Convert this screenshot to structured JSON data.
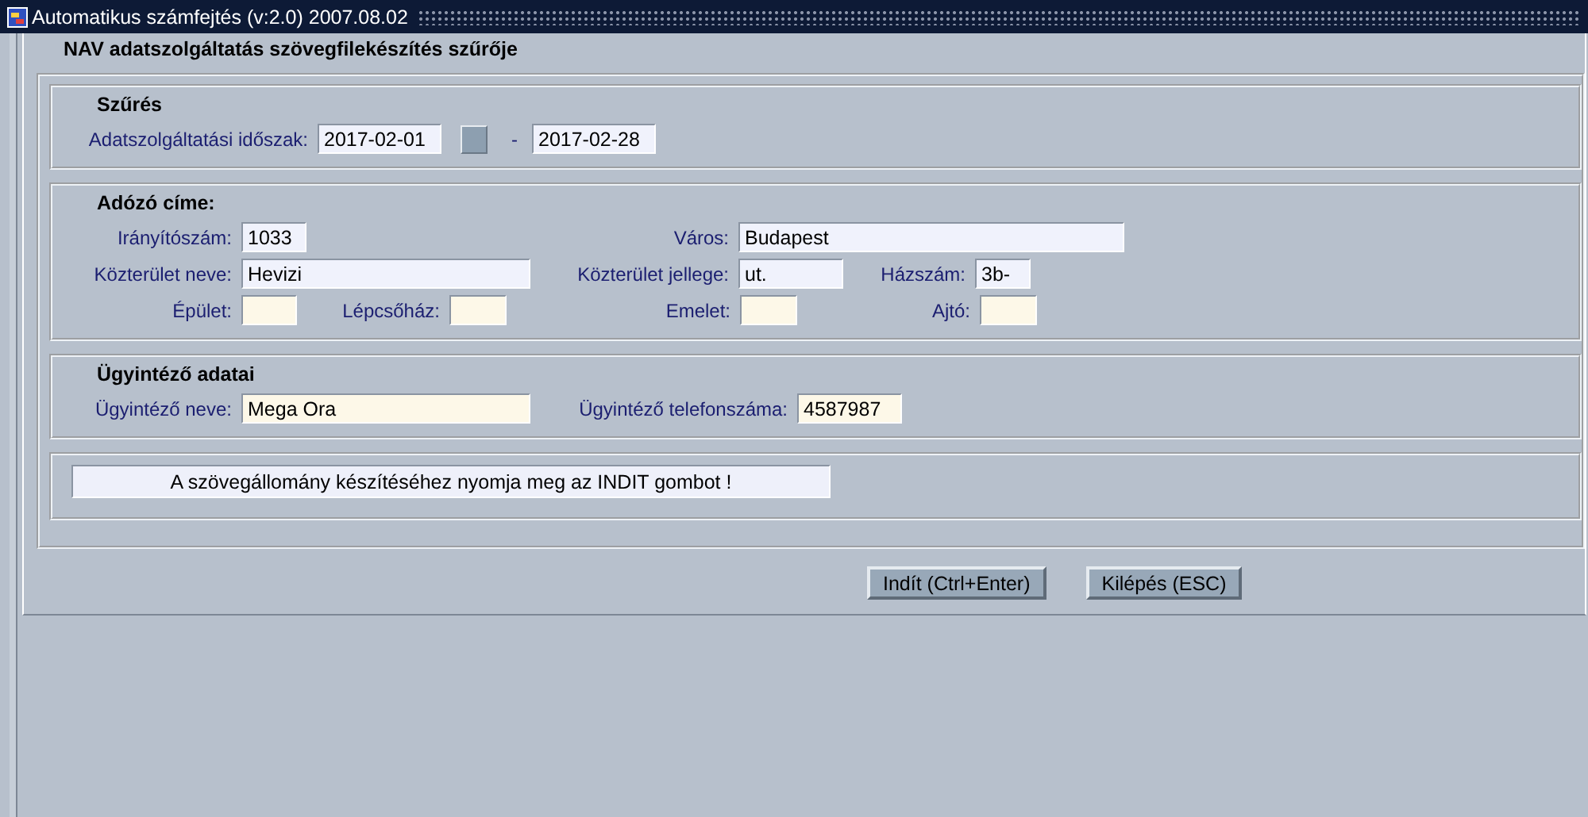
{
  "window": {
    "title": "Automatikus számfejtés (v:2.0) 2007.08.02"
  },
  "form": {
    "title": "NAV adatszolgáltatás szövegfilekészítés szűrője"
  },
  "sections": [
    {
      "title": "Szűrés",
      "rows": [
        [
          {
            "kind": "field",
            "label": "Adatszolgáltatási időszak:",
            "value": "2017-02-01",
            "color": "#f0f2fc"
          },
          {
            "kind": "picker"
          },
          {
            "kind": "separator",
            "label": "-"
          },
          {
            "kind": "field",
            "value": "2017-02-28",
            "color": "#f0f2fc"
          }
        ]
      ]
    },
    {
      "title": "Adózó címe:",
      "rows": [
        [
          {
            "kind": "field",
            "label": "Irányítószám:",
            "value": "1033",
            "color": "#f0f2fc"
          },
          {
            "kind": "gap"
          },
          {
            "kind": "field",
            "label": "Város:",
            "value": "Budapest",
            "color": "#f0f2fc"
          }
        ],
        [
          {
            "kind": "field",
            "label": "Közterület neve:",
            "value": "Hevizi",
            "color": "#f0f2fc"
          },
          {
            "kind": "gap"
          },
          {
            "kind": "field",
            "label": "Közterület jellege:",
            "value": "ut.",
            "color": "#f0f2fc"
          },
          {
            "kind": "field",
            "label": "Házszám:",
            "value": "3b-",
            "color": "#f0f2fc"
          }
        ],
        [
          {
            "kind": "field",
            "label": "Épület:",
            "color": "#fdf8e8"
          },
          {
            "kind": "field",
            "label": "Lépcsőház:",
            "color": "#fdf8e8"
          },
          {
            "kind": "field",
            "label": "Emelet:",
            "color": "#fdf8e8"
          },
          {
            "kind": "field",
            "label": "Ajtó:",
            "color": "#fdf8e8"
          }
        ]
      ]
    },
    {
      "title": "Ügyintéző adatai",
      "rows": [
        [
          {
            "kind": "field",
            "label": "Ügyintéző neve:",
            "value": "Mega Ora",
            "color": "#fdf8e8"
          },
          {
            "kind": "field",
            "label": "Ügyintéző telefonszáma:",
            "value": "4587987",
            "color": "#fdf8e8"
          }
        ]
      ]
    }
  ],
  "message": "A szövegállomány készítéséhez nyomja meg az INDIT gombot !",
  "buttons": [
    "Indít (Ctrl+Enter)",
    "Kilépés (ESC)"
  ]
}
